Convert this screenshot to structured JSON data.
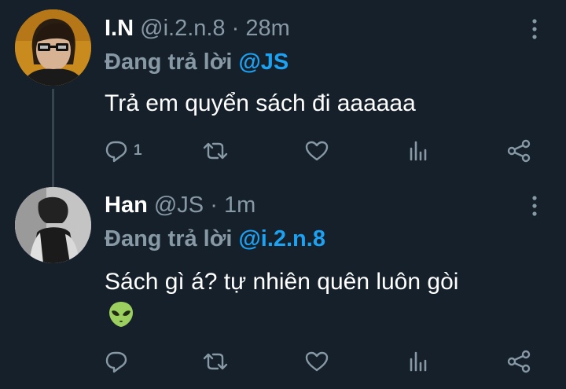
{
  "tweets": [
    {
      "name": "I.N",
      "handle": "@i.2.n.8",
      "separator": "·",
      "time": "28m",
      "replying_prefix": "Đang trả lời",
      "replying_to": "@JS",
      "text": "Trả em quyển sách đi aaaaaa",
      "reply_count": "1"
    },
    {
      "name": "Han",
      "handle": "@JS",
      "separator": "·",
      "time": "1m",
      "replying_prefix": "Đang trả lời",
      "replying_to": "@i.2.n.8",
      "text": "Sách gì á? tự nhiên quên luôn gòi",
      "emoji": "alien"
    }
  ],
  "icons": [
    "reply-icon",
    "retweet-icon",
    "like-icon",
    "analytics-icon",
    "share-icon",
    "more-icon"
  ],
  "colors": {
    "background": "#15202b",
    "muted": "#8899a6",
    "accent": "#1da1f2",
    "thread": "#38444d"
  }
}
